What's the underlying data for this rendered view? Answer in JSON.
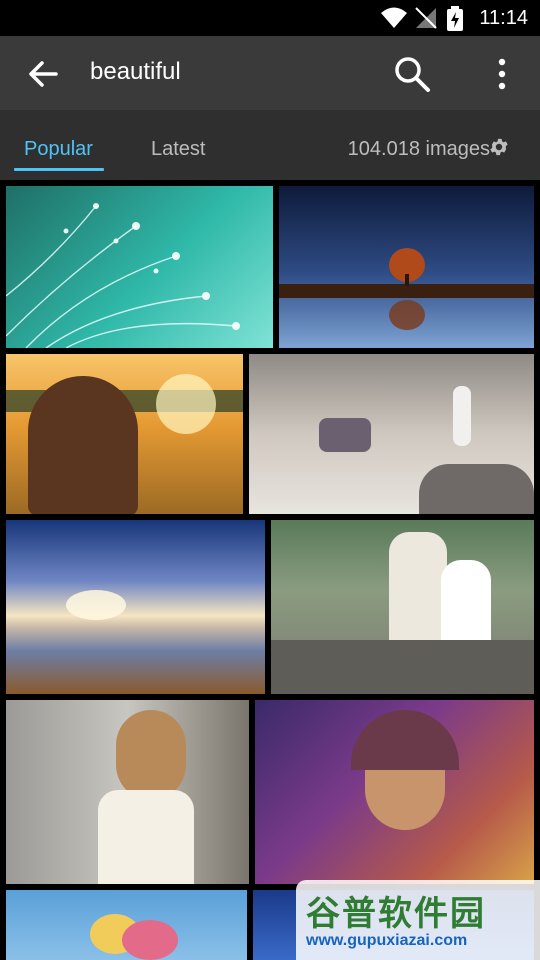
{
  "status": {
    "time": "11:14"
  },
  "header": {
    "query": "beautiful"
  },
  "tabs": [
    {
      "label": "Popular"
    },
    {
      "label": "Latest"
    }
  ],
  "count": "104.018 images",
  "watermark": {
    "cn": "谷普软件园",
    "url": "www.gupuxiazai.com"
  },
  "colors": {
    "accent": "#4fc3f7",
    "appbar": "#3a3a3a",
    "tabbar": "#2f2f2f"
  }
}
